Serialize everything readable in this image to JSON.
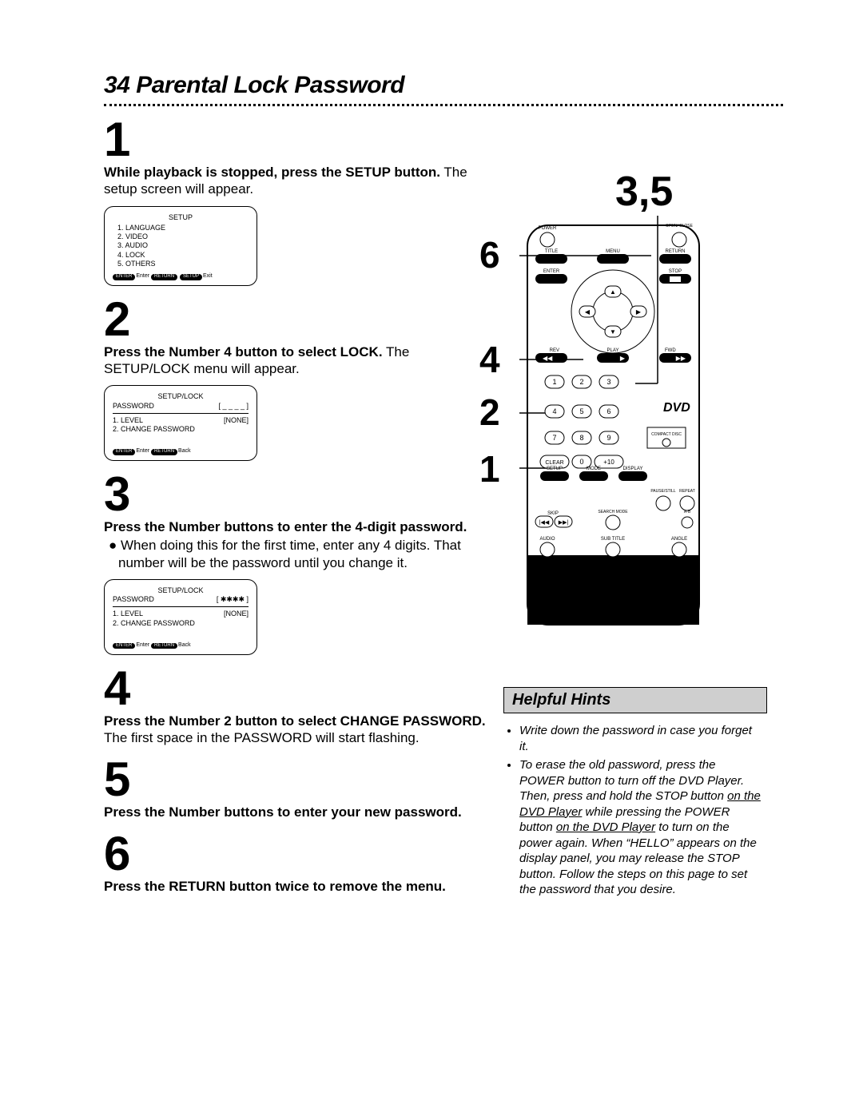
{
  "page_number": "34",
  "title": "Parental Lock Password",
  "steps": [
    {
      "num": "1",
      "bold": "While playback is stopped, press the SETUP button.",
      "rest": " The setup screen will appear."
    },
    {
      "num": "2",
      "bold": "Press the Number 4 button to select LOCK.",
      "rest": " The SETUP/LOCK menu will appear."
    },
    {
      "num": "3",
      "bold": "Press the Number buttons to enter the 4-digit password.",
      "bullet": "When doing this for the first time, enter any 4 digits. That number will be the password until you change it."
    },
    {
      "num": "4",
      "bold": "Press the Number 2 button to select CHANGE PASSWORD.",
      "rest": " The first space in the PASSWORD will start flashing."
    },
    {
      "num": "5",
      "bold": "Press the Number buttons to enter your new password."
    },
    {
      "num": "6",
      "bold": "Press the RETURN button twice to remove the menu."
    }
  ],
  "screen1": {
    "title": "SETUP",
    "items": [
      "1. LANGUAGE",
      "2. VIDEO",
      "3. AUDIO",
      "4. LOCK",
      "5. OTHERS"
    ],
    "foot_labels": [
      "ENTER",
      "RETURN",
      "SETUP"
    ],
    "foot_texts": [
      "Enter",
      "",
      "Exit"
    ]
  },
  "screen2": {
    "title": "SETUP/LOCK",
    "pw_label": "PASSWORD",
    "pw_val": "[ _ _ _ _ ]",
    "items": [
      "1. LEVEL",
      "2. CHANGE PASSWORD"
    ],
    "level_val": "[NONE]",
    "foot_labels": [
      "ENTER",
      "RETURN"
    ],
    "foot_texts": [
      "Enter",
      "Back"
    ]
  },
  "screen3": {
    "title": "SETUP/LOCK",
    "pw_label": "PASSWORD",
    "pw_val": "[ ✱✱✱✱ ]",
    "items": [
      "1. LEVEL",
      "2. CHANGE PASSWORD"
    ],
    "level_val": "[NONE]",
    "foot_labels": [
      "ENTER",
      "RETURN"
    ],
    "foot_texts": [
      "Enter",
      "Back"
    ]
  },
  "callouts": {
    "r35": "3,5",
    "r6": "6",
    "r4": "4",
    "r2": "2",
    "r1": "1"
  },
  "remote": {
    "power": "POWER",
    "open": "OPEN/\nCLOSE",
    "title_btn": "TITLE",
    "menu": "MENU",
    "ret": "RETURN",
    "enter": "ENTER",
    "stop": "STOP",
    "rev": "REV",
    "play": "PLAY",
    "fwd": "FWD",
    "num": [
      "1",
      "2",
      "3",
      "4",
      "5",
      "6",
      "7",
      "8",
      "9",
      "0",
      "+10"
    ],
    "clear": "CLEAR",
    "setup": "SETUP",
    "mode": "MODE",
    "display": "DISPLAY",
    "pause": "PAUSE/STILL",
    "repeat": "REPEAT",
    "skip": "SKIP",
    "search": "SEARCH MODE",
    "ab": "A-B",
    "audio": "AUDIO",
    "subtitle": "SUB TITLE",
    "angle": "ANGLE",
    "logo_dvd": "DVD",
    "logo_cd": "COMPACT DISC"
  },
  "hints": {
    "title": "Helpful Hints",
    "items": [
      "Write down the password in case you forget it.",
      "To erase the old password, press the POWER button to turn off the DVD Player. Then, press and hold the STOP button <u>on the DVD Player</u> while pressing the POWER button <u>on the DVD Player</u> to turn on the power again. When “HELLO” appears on the display panel, you may release the STOP button. Follow the steps on this page to set the password that you desire."
    ]
  }
}
